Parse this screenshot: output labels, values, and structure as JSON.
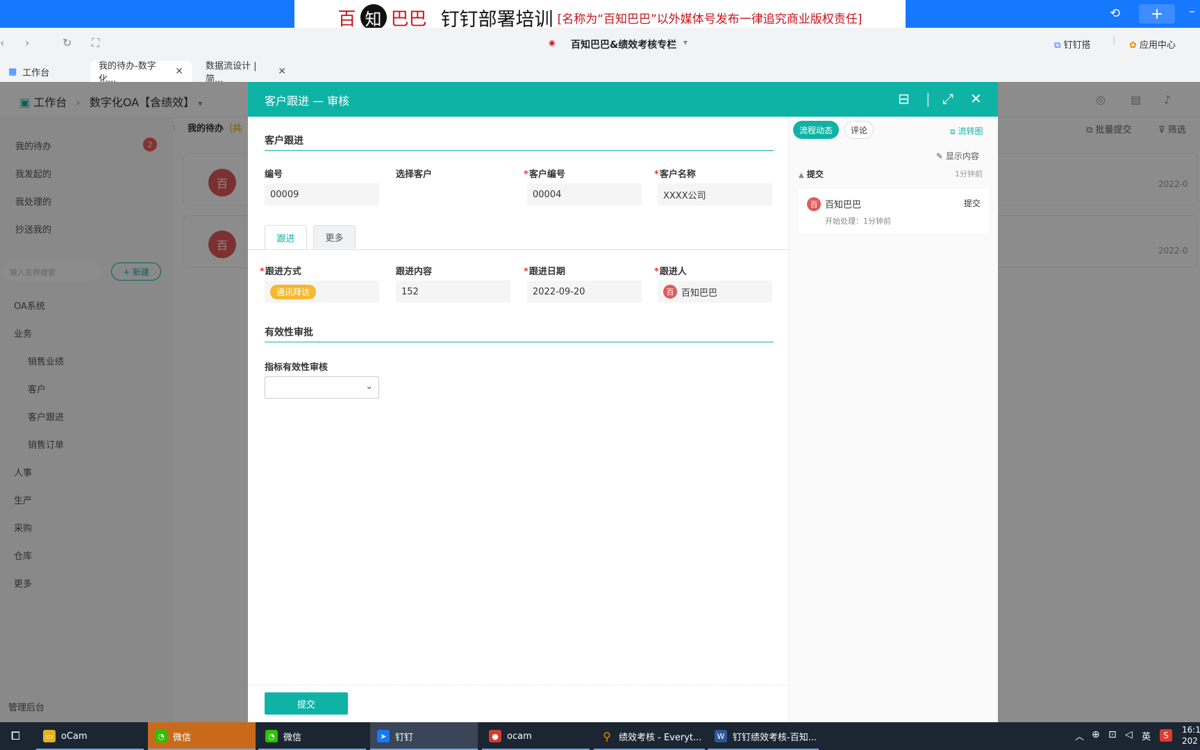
{
  "banner": {
    "brand_1": "百",
    "brand_2": "知",
    "brand_3": "巴巴",
    "title": "钉钉部署培训",
    "note": "[名称为“百知巴巴”以外媒体号发布一律追究商业版权责任]"
  },
  "header": {
    "app_title": "百知巴巴&绩效考核专栏",
    "dingtalk_link": "钉钉搭",
    "app_center": "应用中心"
  },
  "tabs": [
    {
      "label": "工作台"
    },
    {
      "label": "我的待办-数字化..."
    },
    {
      "label": "数据流设计 | 简..."
    }
  ],
  "background": {
    "breadcrumb_home": "工作台",
    "breadcrumb_app": "数字化OA【含绩效】",
    "list_title": "我的待办",
    "list_title_suffix": "（共",
    "batch_submit": "批量提交",
    "filter": "筛选",
    "date_stub": "2022-0",
    "sidebar": {
      "todo": "我的待办",
      "todo_badge": "2",
      "initiated": "我发起的",
      "handled": "我处理的",
      "cc": "抄送我的",
      "search_placeholder": "输入名称搜索",
      "new_btn": "+ 新建",
      "groups": [
        "OA系统",
        "业务",
        "人事",
        "生产",
        "采购",
        "仓库",
        "更多"
      ],
      "business_items": [
        "销售业绩",
        "客户",
        "客户跟进",
        "销售订单"
      ],
      "admin": "管理后台"
    },
    "row_avatar": "百"
  },
  "modal": {
    "title": "客户跟进 — 审核",
    "section1": "客户跟进",
    "fields_row1": [
      {
        "label": "编号",
        "required": false,
        "value": "00009"
      },
      {
        "label": "选择客户",
        "required": false,
        "value": ""
      },
      {
        "label": "客户编号",
        "required": true,
        "value": "00004"
      },
      {
        "label": "客户名称",
        "required": true,
        "value": "XXXX公司"
      }
    ],
    "tab_follow": "跟进",
    "tab_more": "更多",
    "fields_row2": [
      {
        "label": "跟进方式",
        "required": true,
        "value": "通讯拜访"
      },
      {
        "label": "跟进内容",
        "required": false,
        "value": "152"
      },
      {
        "label": "跟进日期",
        "required": true,
        "value": "2022-09-20"
      },
      {
        "label": "跟进人",
        "required": true,
        "value": "百知巴巴"
      }
    ],
    "person_avatar": "百",
    "section2": "有效性审批",
    "select_label": "指标有效性审核",
    "select_value": "",
    "submit": "提交"
  },
  "right_panel": {
    "tab_flow": "流程动态",
    "tab_comment": "评论",
    "flowchart": "流转图",
    "show_content": "显示内容",
    "step_name": "提交",
    "step_time": "1分钟前",
    "card_avatar": "百",
    "card_name": "百知巴巴",
    "card_action": "提交",
    "card_detail": "开始处理：1分钟前"
  },
  "taskbar": {
    "items": [
      "oCam",
      "微信",
      "微信",
      "钉钉",
      "ocam",
      "绩效考核 - Everyt...",
      "钉钉绩效考核-百知..."
    ],
    "ime": "英",
    "clock": "16:1",
    "date": "202"
  },
  "colors": {
    "accent": "#0fb3a6",
    "topbar": "#1677ff",
    "required": "#e53935",
    "tag": "#f5b82e"
  }
}
